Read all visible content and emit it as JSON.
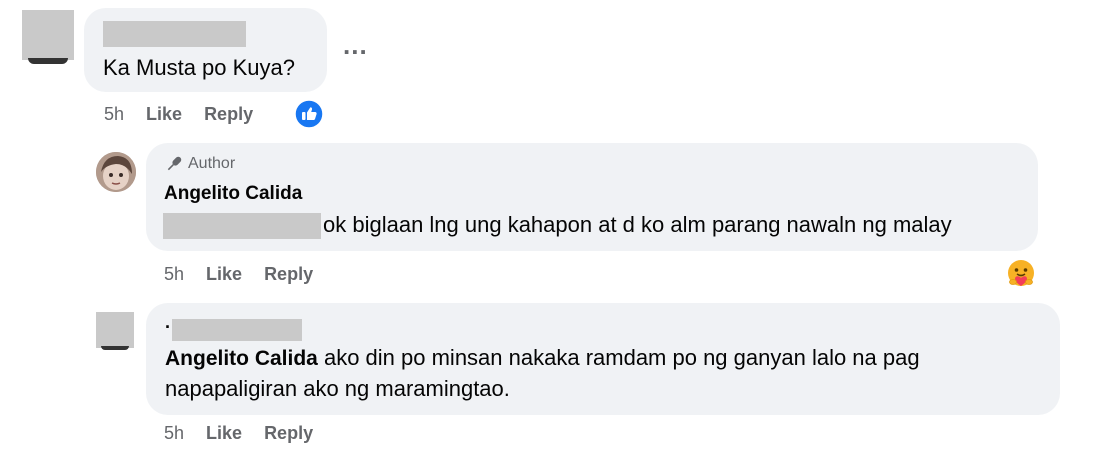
{
  "comments": [
    {
      "text": "Ka Musta po Kuya?",
      "time": "5h",
      "like_label": "Like",
      "reply_label": "Reply",
      "reaction_icon": "like-reaction-icon",
      "more_label": "..."
    },
    {
      "badge_label": "Author",
      "author_name": "Angelito Calida",
      "text": "ok biglaan lng ung kahapon at d ko alm parang nawaln ng malay",
      "time": "5h",
      "like_label": "Like",
      "reply_label": "Reply",
      "reaction_icon": "care-reaction-icon"
    },
    {
      "name_prefix": ".",
      "mention": "Angelito Calida",
      "text_line1": " ako din po minsan nakaka ramdam po ng ganyan lalo na pag",
      "text_line2": "napapaligiran ako ng maramingtao.",
      "time": "5h",
      "like_label": "Like",
      "reply_label": "Reply"
    }
  ],
  "colors": {
    "bubble": "#f0f2f5",
    "meta": "#65676b",
    "like_blue": "#1877f2",
    "redaction": "#c9c9c9"
  }
}
